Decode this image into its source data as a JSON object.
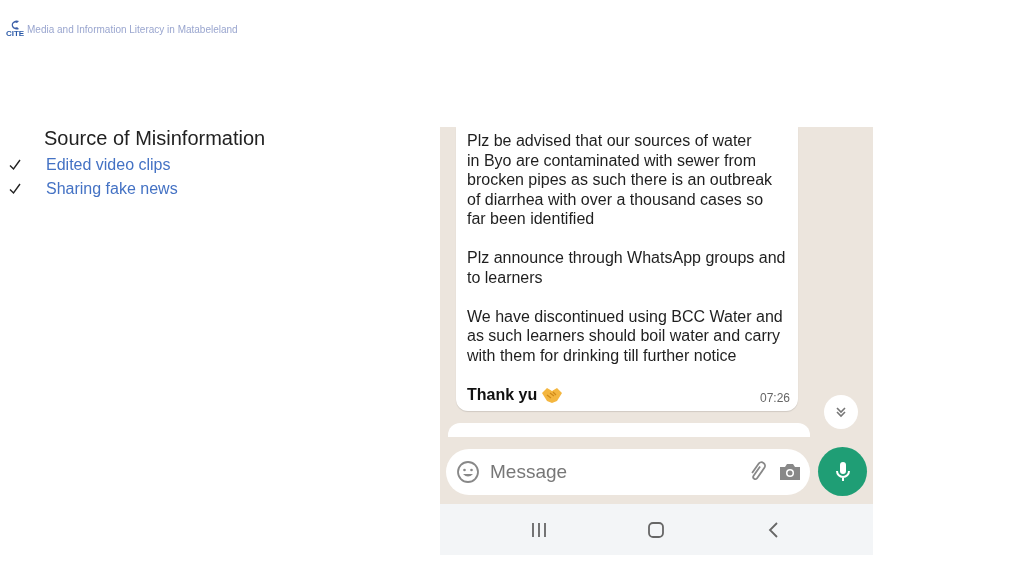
{
  "header": {
    "logo_text": "CITE",
    "title": "Media and Information Literacy in Matabeleland"
  },
  "content": {
    "heading": "Source of Misinformation",
    "items": [
      {
        "label": "Edited video clips",
        "checked": true
      },
      {
        "label": "Sharing fake news",
        "checked": true
      }
    ]
  },
  "chat": {
    "message": {
      "paragraphs": [
        [
          "Plz be advised that our sources of water",
          "in Byo are contaminated with sewer from",
          "brocken pipes as such there is an outbreak",
          "of diarrhea with over a thousand cases so",
          "far been identified"
        ],
        [
          "Plz announce through WhatsApp groups and",
          "to learners"
        ],
        [
          "We have discontinued using BCC Water and",
          "as such learners should boil water and carry",
          "with them for drinking till further notice"
        ]
      ],
      "sign_off": "Thank yu",
      "time": "07:26"
    },
    "composer": {
      "placeholder": "Message"
    }
  }
}
